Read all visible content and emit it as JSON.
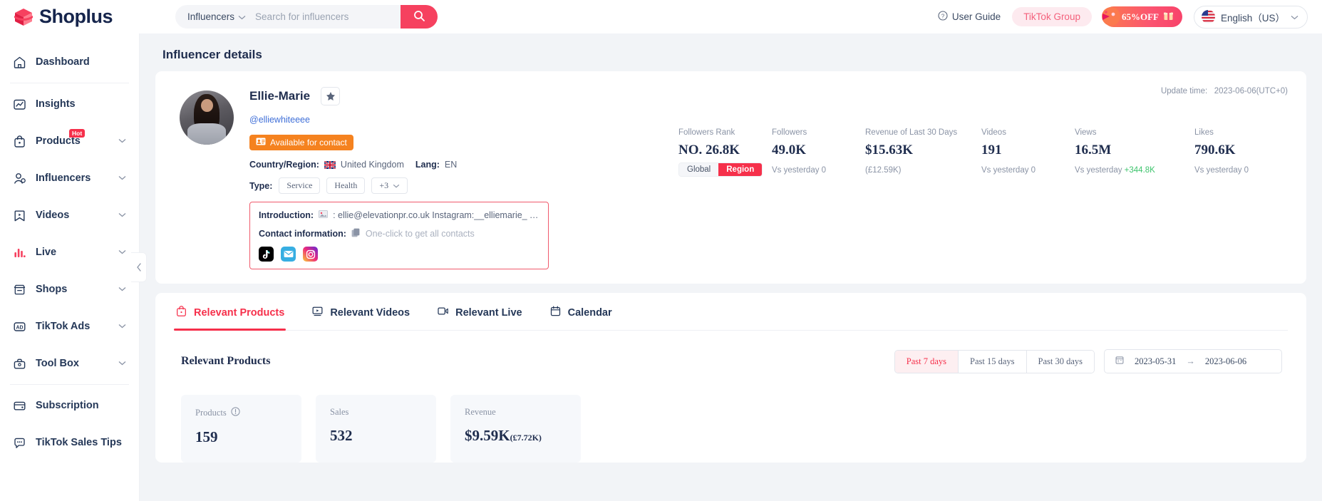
{
  "brand": {
    "name": "Shoplus",
    "accent": "#f6304b"
  },
  "header": {
    "search": {
      "category": "Influencers",
      "placeholder": "Search for influencers",
      "value": ""
    },
    "user_guide": "User Guide",
    "tiktok_group": "TikTok Group",
    "promo": "65%OFF",
    "language": "English（US）"
  },
  "sidebar": {
    "items": [
      {
        "label": "Dashboard",
        "icon": "home-icon",
        "expandable": false
      },
      {
        "label": "Insights",
        "icon": "insights-icon",
        "expandable": false
      },
      {
        "label": "Products",
        "icon": "products-icon",
        "expandable": true,
        "badge": "Hot"
      },
      {
        "label": "Influencers",
        "icon": "influencers-icon",
        "expandable": true
      },
      {
        "label": "Videos",
        "icon": "videos-icon",
        "expandable": true
      },
      {
        "label": "Live",
        "icon": "live-icon",
        "expandable": true
      },
      {
        "label": "Shops",
        "icon": "shops-icon",
        "expandable": true
      },
      {
        "label": "TikTok Ads",
        "icon": "ads-icon",
        "expandable": true
      },
      {
        "label": "Tool Box",
        "icon": "toolbox-icon",
        "expandable": true
      }
    ],
    "bottom_items": [
      {
        "label": "Subscription",
        "icon": "subscription-icon"
      },
      {
        "label": "TikTok Sales Tips",
        "icon": "tips-icon"
      }
    ]
  },
  "page": {
    "title": "Influencer details"
  },
  "profile": {
    "name": "Ellie-Marie",
    "handle": "@elliewhiteeee",
    "available_badge": "Available for contact",
    "country_label": "Country/Region:",
    "country_value": "United Kingdom",
    "lang_label": "Lang:",
    "lang_value": "EN",
    "type_label": "Type:",
    "types": [
      "Service",
      "Health"
    ],
    "types_more": "+3",
    "introduction_label": "Introduction:",
    "introduction_value": ": ellie@elevationpr.co.uk Instagram:__elliemarie_ YouTube: E…",
    "contact_label": "Contact information:",
    "contact_hint": "One-click to get all contacts",
    "socials": [
      "tiktok-icon",
      "mail-icon",
      "instagram-icon"
    ],
    "update_time_label": "Update time:",
    "update_time_value": "2023-06-06(UTC+0)"
  },
  "stats": [
    {
      "label": "Followers Rank",
      "value": "NO. 26.8K",
      "seg": [
        "Global",
        "Region"
      ],
      "seg_active": 1
    },
    {
      "label": "Followers",
      "value": "49.0K",
      "sub": "Vs yesterday 0"
    },
    {
      "label": "Revenue of Last 30 Days",
      "value": "$15.63K",
      "sub": "(£12.59K)"
    },
    {
      "label": "Videos",
      "value": "191",
      "sub": "Vs yesterday 0"
    },
    {
      "label": "Views",
      "value": "16.5M",
      "sub": "Vs yesterday ",
      "sub_up": "+344.8K"
    },
    {
      "label": "Likes",
      "value": "790.6K",
      "sub": "Vs yesterday 0"
    }
  ],
  "tabs": [
    {
      "label": "Relevant Products",
      "icon": "bag-icon",
      "active": true
    },
    {
      "label": "Relevant Videos",
      "icon": "video-icon",
      "active": false
    },
    {
      "label": "Relevant Live",
      "icon": "live-stream-icon",
      "active": false
    },
    {
      "label": "Calendar",
      "icon": "calendar-icon",
      "active": false
    }
  ],
  "section": {
    "title": "Relevant Products",
    "ranges": [
      "Past 7 days",
      "Past 15 days",
      "Past 30 days"
    ],
    "range_active": 0,
    "date_start": "2023-05-31",
    "date_end": "2023-06-06",
    "date_arrow": "→"
  },
  "metrics": [
    {
      "label": "Products",
      "has_info": true,
      "value": "159",
      "sub": ""
    },
    {
      "label": "Sales",
      "has_info": false,
      "value": "532",
      "sub": ""
    },
    {
      "label": "Revenue",
      "has_info": false,
      "value": "$9.59K",
      "sub": "(£7.72K)"
    }
  ]
}
